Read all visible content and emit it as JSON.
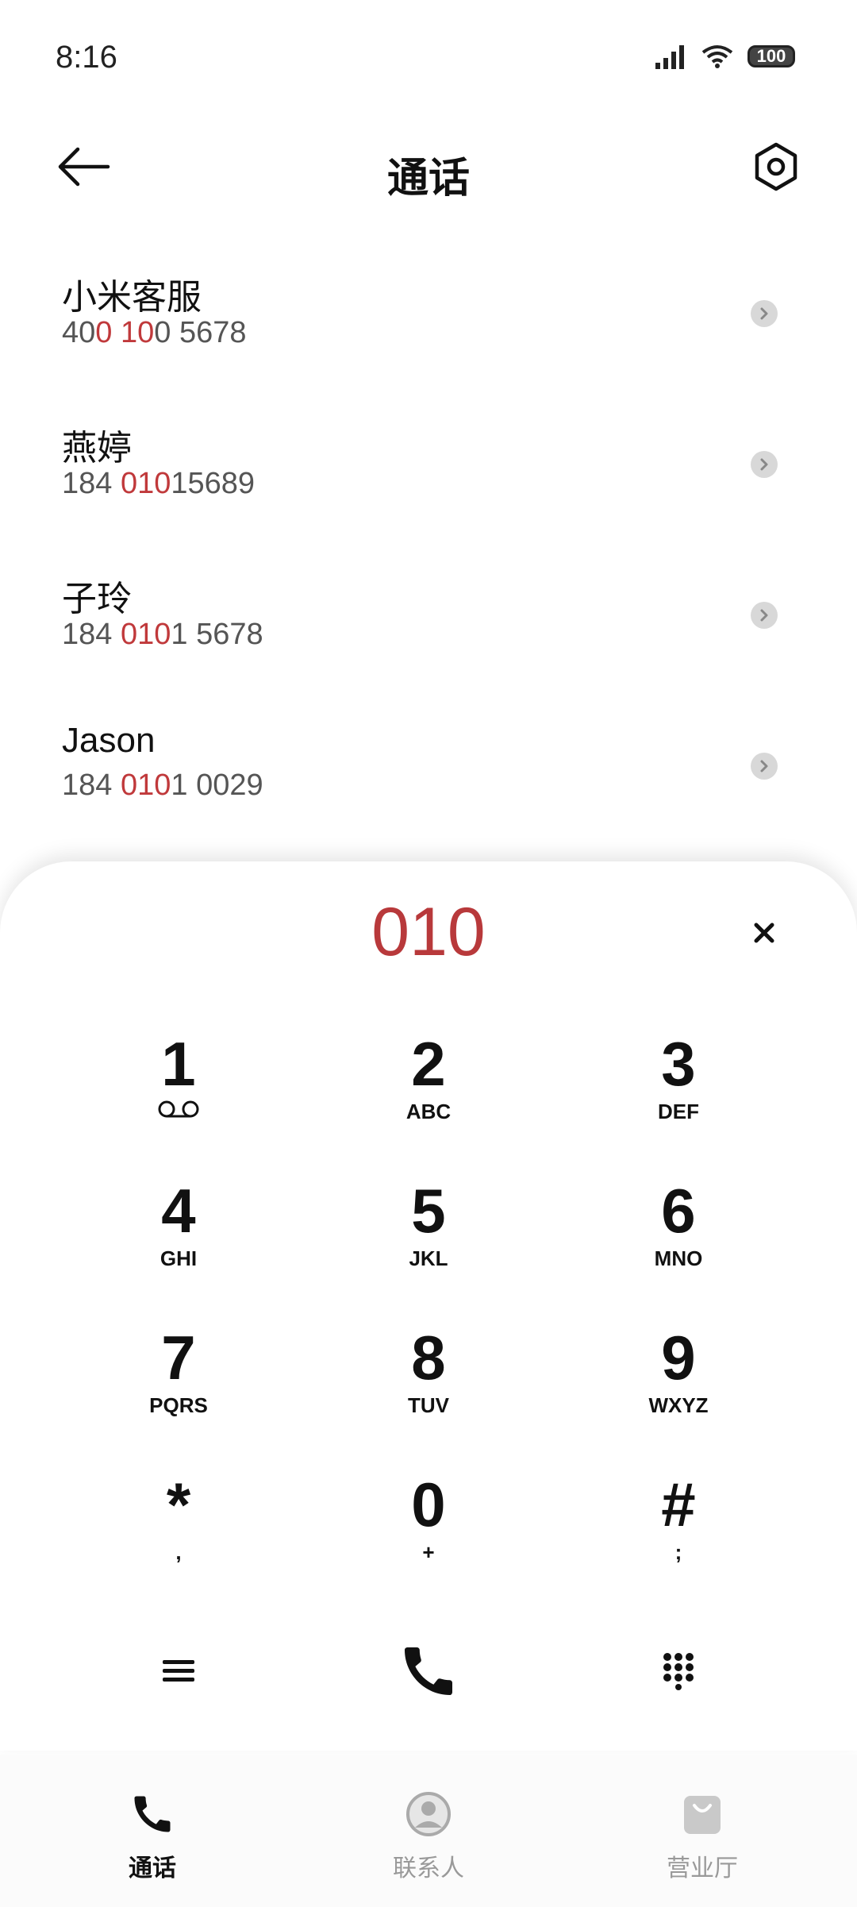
{
  "status": {
    "time": "8:16",
    "battery": "100"
  },
  "header": {
    "title": "通话"
  },
  "contacts": [
    {
      "name": "小米客服",
      "number_parts": [
        "40",
        "0",
        " ",
        "10",
        "0 5678"
      ]
    },
    {
      "name": "燕婷",
      "number_parts": [
        "184 ",
        "010",
        "15689"
      ]
    },
    {
      "name": "子玲",
      "number_parts": [
        "184 ",
        "010",
        "1 5678"
      ]
    },
    {
      "name": "Jason",
      "number_parts": [
        "184 ",
        "010",
        "1 0029"
      ]
    }
  ],
  "dialer": {
    "input": "010",
    "keys": [
      {
        "digit": "1",
        "letters": ""
      },
      {
        "digit": "2",
        "letters": "ABC"
      },
      {
        "digit": "3",
        "letters": "DEF"
      },
      {
        "digit": "4",
        "letters": "GHI"
      },
      {
        "digit": "5",
        "letters": "JKL"
      },
      {
        "digit": "6",
        "letters": "MNO"
      },
      {
        "digit": "7",
        "letters": "PQRS"
      },
      {
        "digit": "8",
        "letters": "TUV"
      },
      {
        "digit": "9",
        "letters": "WXYZ"
      },
      {
        "digit": "*",
        "letters": ","
      },
      {
        "digit": "0",
        "letters": "+"
      },
      {
        "digit": "#",
        "letters": ";"
      }
    ]
  },
  "nav": {
    "items": [
      {
        "label": "通话",
        "icon": "phone-icon",
        "active": true
      },
      {
        "label": "联系人",
        "icon": "contact-icon",
        "active": false
      },
      {
        "label": "营业厅",
        "icon": "shop-bag-icon",
        "active": false
      }
    ]
  },
  "colors": {
    "highlight": "#c0393b",
    "dial_input": "#b8393b"
  }
}
